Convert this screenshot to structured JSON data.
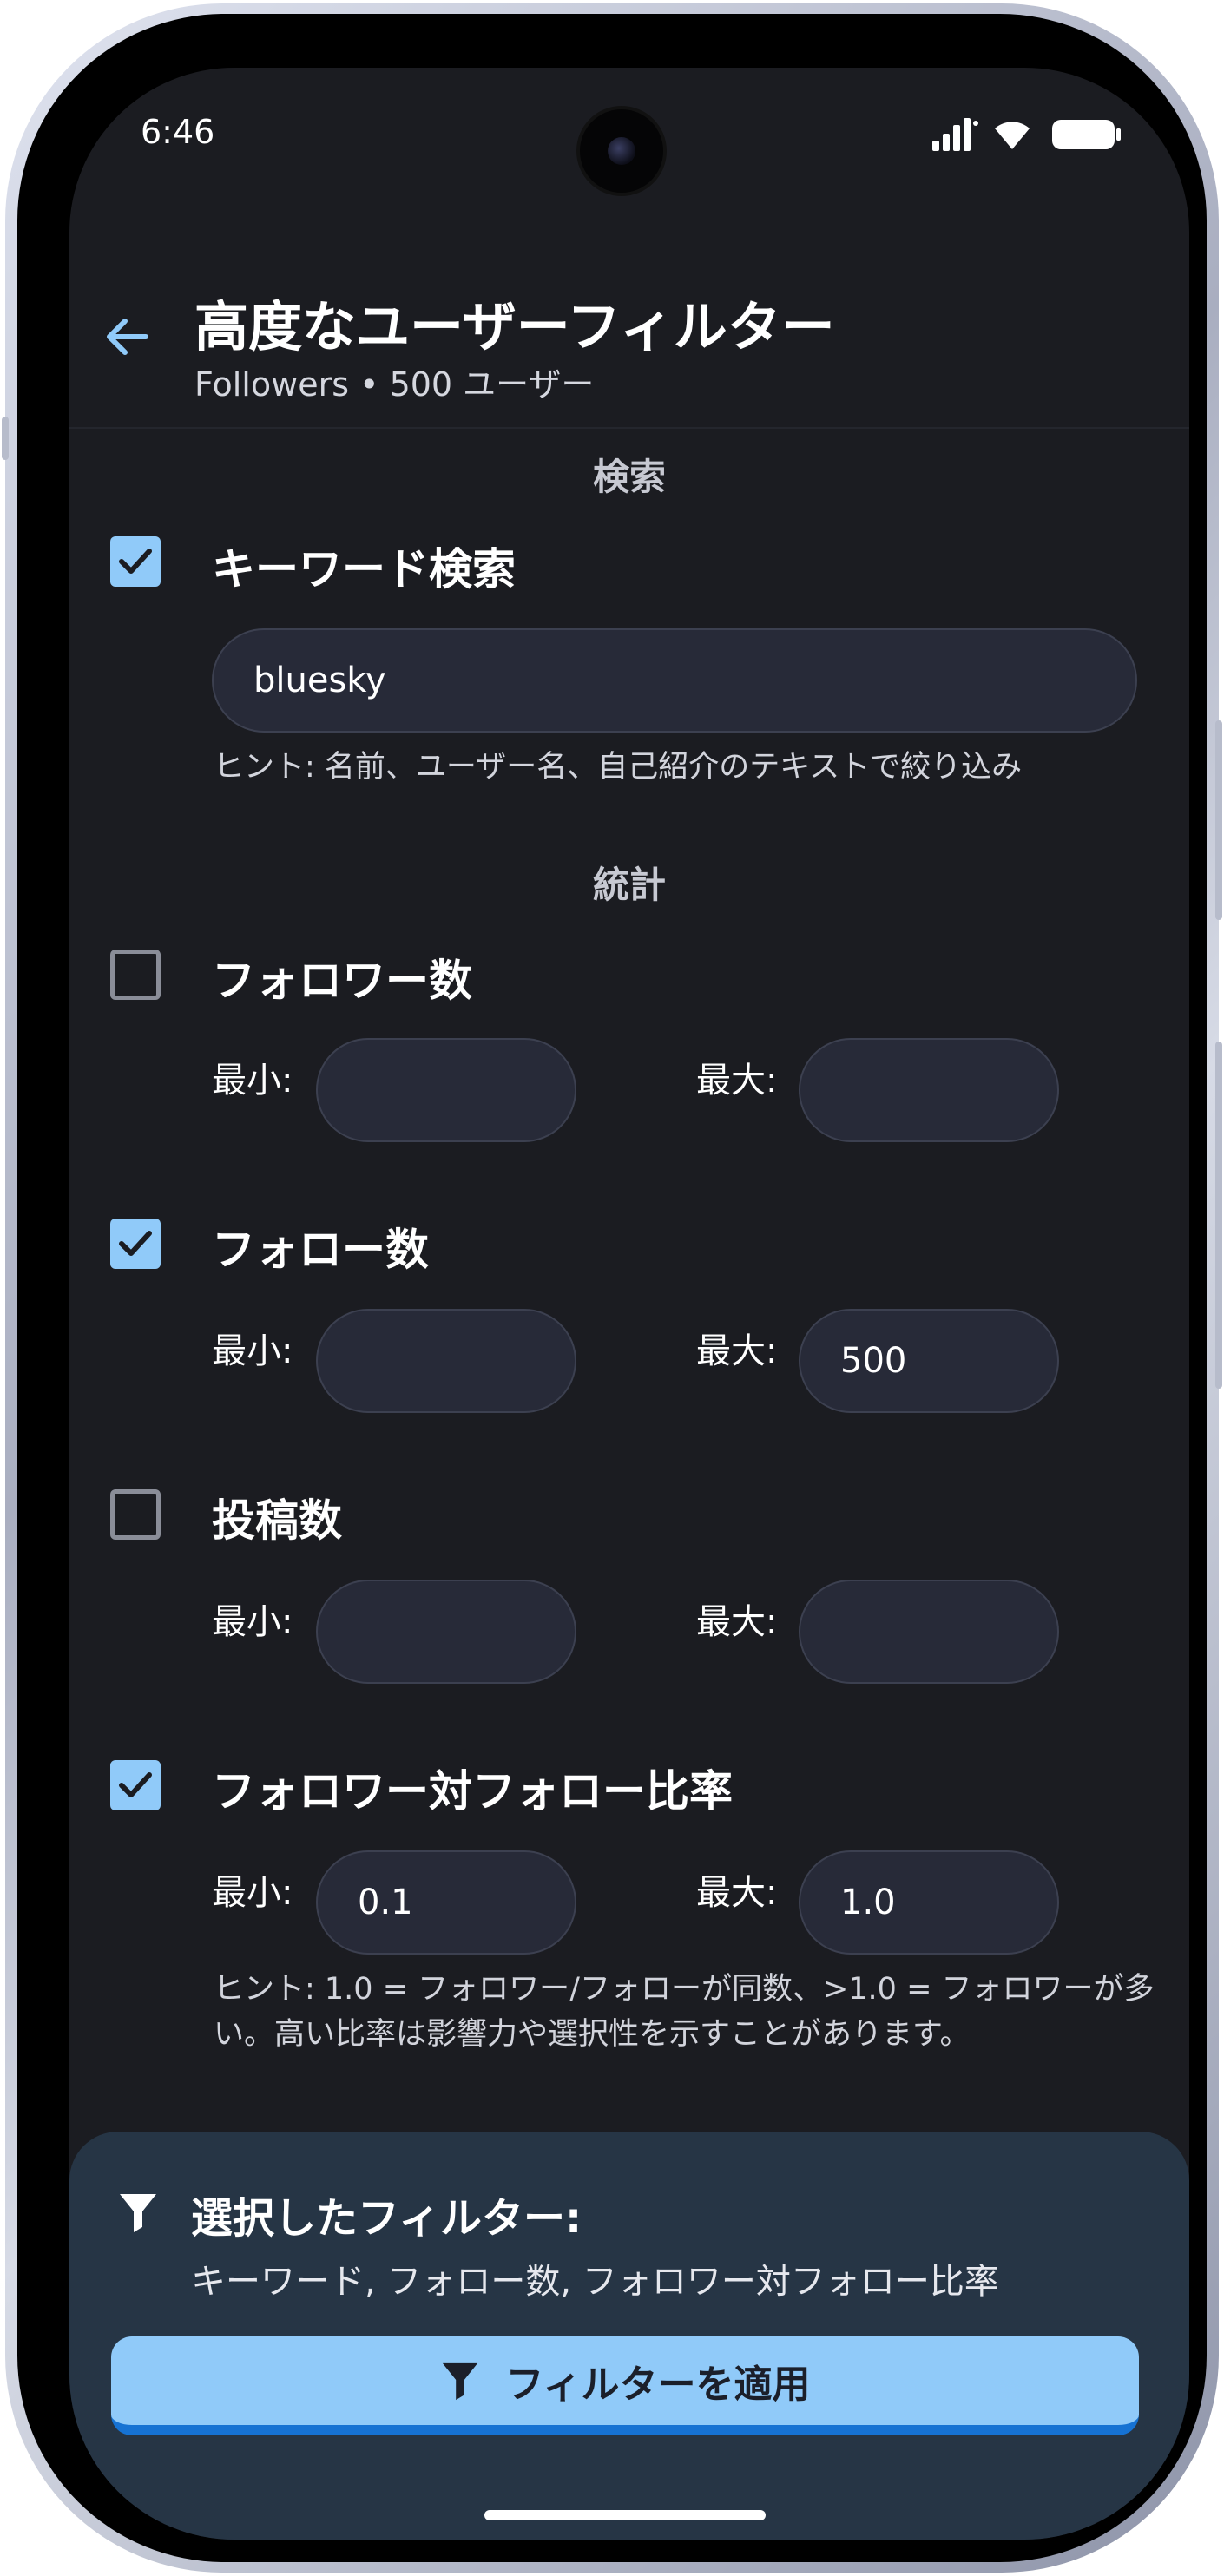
{
  "status_bar": {
    "time": "6:46"
  },
  "app_bar": {
    "title": "高度なユーザーフィルター",
    "subtitle": "Followers • 500 ユーザー"
  },
  "sections": {
    "search": "検索",
    "stats": "統計"
  },
  "keyword": {
    "label": "キーワード検索",
    "checked": true,
    "value": "bluesky",
    "hint": "ヒント: 名前、ユーザー名、自己紹介のテキストで絞り込み"
  },
  "range_labels": {
    "min": "最小:",
    "max": "最大:"
  },
  "filters": {
    "followers": {
      "label": "フォロワー数",
      "checked": false,
      "min": "",
      "max": ""
    },
    "following": {
      "label": "フォロー数",
      "checked": true,
      "min": "",
      "max": "500"
    },
    "posts": {
      "label": "投稿数",
      "checked": false,
      "min": "",
      "max": ""
    },
    "ratio": {
      "label": "フォロワー対フォロー比率",
      "checked": true,
      "min": "0.1",
      "max": "1.0",
      "hint": "ヒント: 1.0 = フォロワー/フォローが同数、>1.0 = フォロワーが多い。高い比率は影響力や選択性を示すことがあります。"
    }
  },
  "summary": {
    "title": "選択したフィルター:",
    "text": "キーワード, フォロー数, フォロワー対フォロー比率"
  },
  "apply_button": {
    "label": "フィルターを適用"
  },
  "colors": {
    "accent": "#90caf9",
    "background": "#1b1c21",
    "panel": "#263545",
    "field": "#272a38",
    "button_border": "#1672d3"
  }
}
